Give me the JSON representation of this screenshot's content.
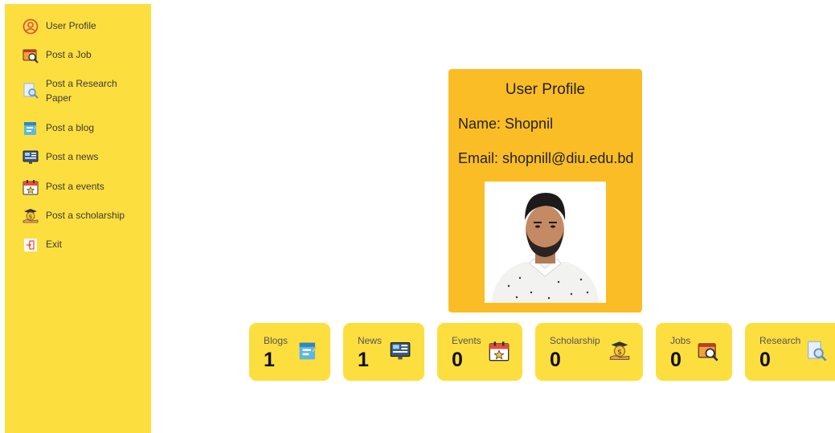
{
  "sidebar": {
    "items": [
      {
        "label": "User Profile",
        "icon": "user-profile-icon"
      },
      {
        "label": "Post a Job",
        "icon": "job-icon"
      },
      {
        "label": "Post a Research Paper",
        "icon": "research-icon"
      },
      {
        "label": "Post a blog",
        "icon": "blog-icon"
      },
      {
        "label": "Post a news",
        "icon": "news-icon"
      },
      {
        "label": "Post a events",
        "icon": "calendar-icon"
      },
      {
        "label": "Post a scholarship",
        "icon": "scholarship-icon"
      },
      {
        "label": "Exit",
        "icon": "exit-icon"
      }
    ]
  },
  "profile": {
    "title": "User Profile",
    "name_line": "Name: Shopnil",
    "email_line": "Email: shopnill@diu.edu.bd"
  },
  "stats": [
    {
      "label": "Blogs",
      "value": "1",
      "icon": "blog-icon"
    },
    {
      "label": "News",
      "value": "1",
      "icon": "news-icon"
    },
    {
      "label": "Events",
      "value": "0",
      "icon": "calendar-icon"
    },
    {
      "label": "Scholarship",
      "value": "0",
      "icon": "scholarship-icon"
    },
    {
      "label": "Jobs",
      "value": "0",
      "icon": "job-icon"
    },
    {
      "label": "Research",
      "value": "0",
      "icon": "research-icon"
    }
  ],
  "colors": {
    "sidebar_bg": "#fdde3f",
    "profile_bg": "#fbbd25",
    "card_bg": "#fdde3f"
  }
}
